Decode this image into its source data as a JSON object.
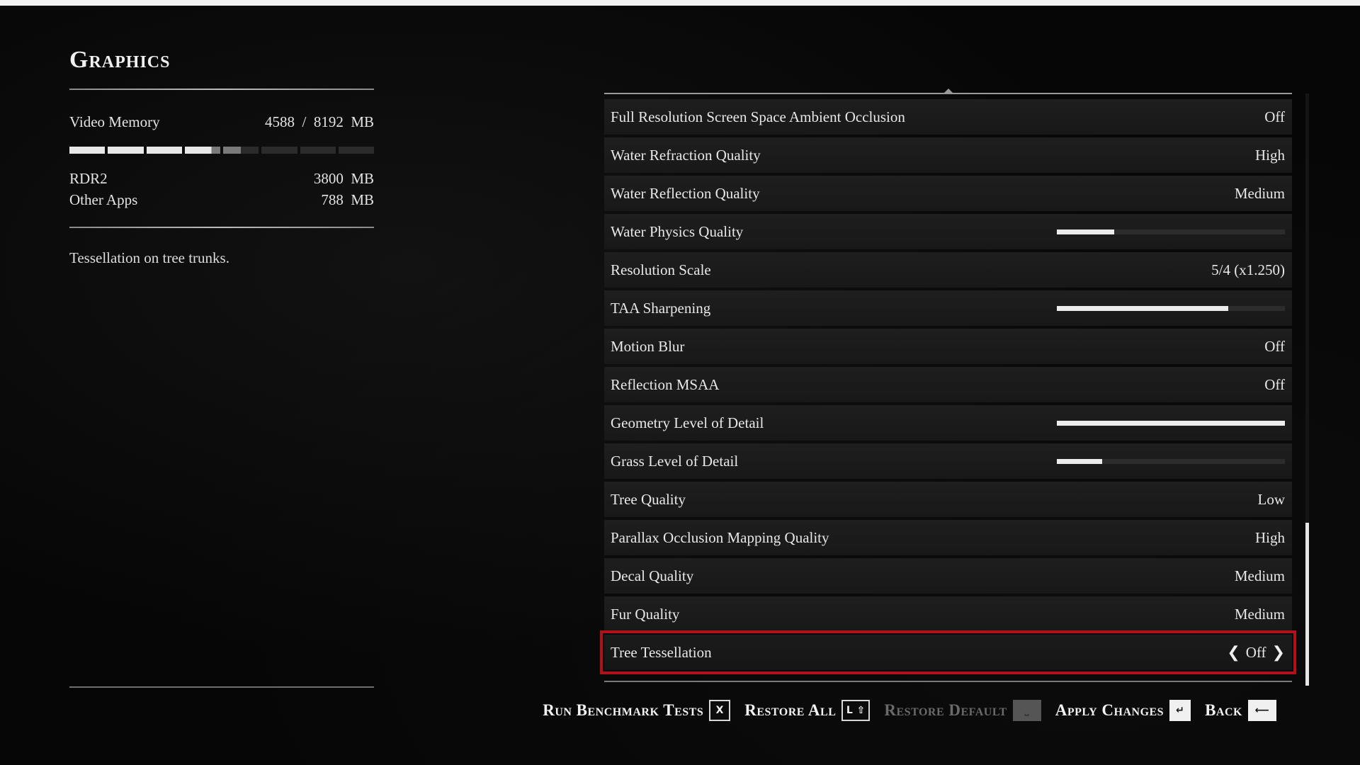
{
  "left": {
    "title": "Graphics",
    "video_memory_label": "Video Memory",
    "video_memory_value": "4588  /  8192  MB",
    "memory_bar": {
      "used_fraction": 0.56,
      "other_fraction": 0.1,
      "segments": 8
    },
    "rdr2_label": "RDR2",
    "rdr2_value": "3800  MB",
    "other_label": "Other Apps",
    "other_value": "788  MB",
    "description": "Tessellation on tree trunks."
  },
  "settings": [
    {
      "label": "Full Resolution Screen Space Ambient Occlusion",
      "value": "Off"
    },
    {
      "label": "Water Refraction Quality",
      "value": "High"
    },
    {
      "label": "Water Reflection Quality",
      "value": "Medium"
    },
    {
      "label": "Water Physics Quality",
      "slider": 0.25
    },
    {
      "label": "Resolution Scale",
      "value": "5/4 (x1.250)"
    },
    {
      "label": "TAA Sharpening",
      "slider": 0.75
    },
    {
      "label": "Motion Blur",
      "value": "Off"
    },
    {
      "label": "Reflection MSAA",
      "value": "Off"
    },
    {
      "label": "Geometry Level of Detail",
      "slider": 1.0
    },
    {
      "label": "Grass Level of Detail",
      "slider": 0.2
    },
    {
      "label": "Tree Quality",
      "value": "Low"
    },
    {
      "label": "Parallax Occlusion Mapping Quality",
      "value": "High"
    },
    {
      "label": "Decal Quality",
      "value": "Medium"
    },
    {
      "label": "Fur Quality",
      "value": "Medium"
    },
    {
      "label": "Tree Tessellation",
      "value": "Off",
      "selected": true
    }
  ],
  "footer": {
    "run_benchmark": "Run Benchmark Tests",
    "run_benchmark_key": "X",
    "restore_all": "Restore All",
    "restore_all_key": "L ⇧",
    "restore_default": "Restore Default",
    "restore_default_key": "⎵",
    "apply_changes": "Apply Changes",
    "apply_changes_key": "↵",
    "back": "Back",
    "back_key": "⟵"
  },
  "colors": {
    "selection_outline": "#b3111a"
  }
}
